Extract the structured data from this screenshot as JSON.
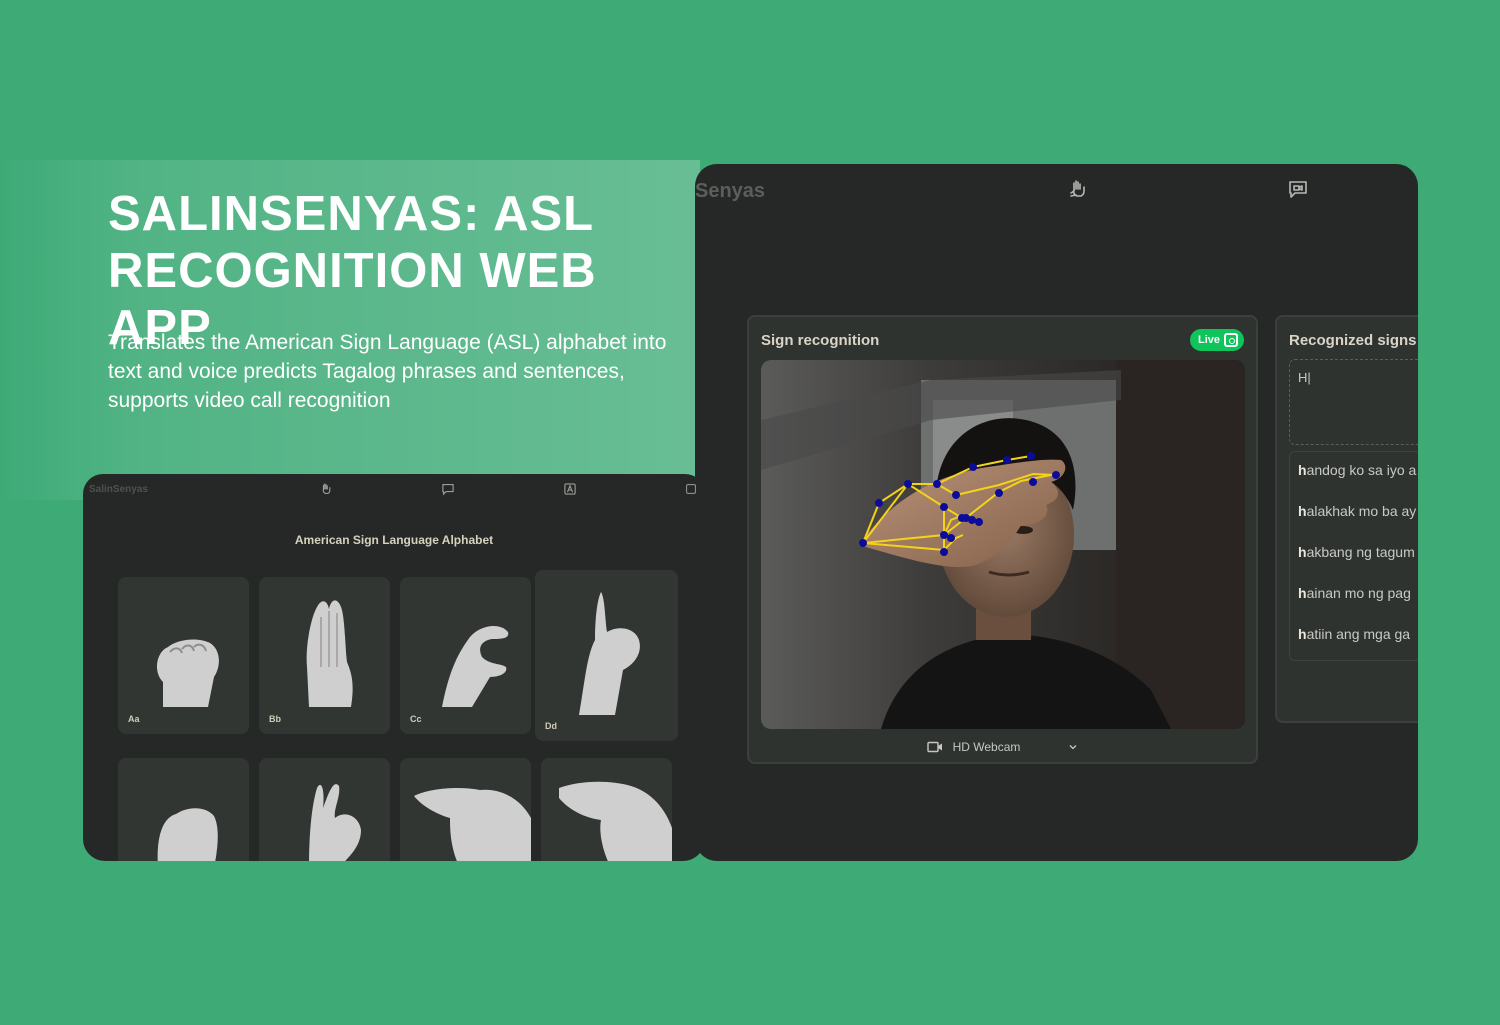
{
  "hero": {
    "title": "SALINSENYAS: ASL RECOGNITION WEB APP",
    "description": "Translates the American Sign Language (ASL) alphabet into text and voice predicts Tagalog phrases and sentences, supports video call recognition"
  },
  "main_app": {
    "logo": "Senyas",
    "nav_icons": [
      "sign-language-icon",
      "video-chat-icon"
    ],
    "sign_recognition": {
      "title": "Sign recognition",
      "live_badge": "Live",
      "camera_label": "HD Webcam"
    },
    "recognized_signs": {
      "title": "Recognized signs",
      "input_value": "H|",
      "suggestions": [
        {
          "prefix": "h",
          "rest": "andog ko sa iyo a"
        },
        {
          "prefix": "h",
          "rest": "alakhak mo ba ay"
        },
        {
          "prefix": "h",
          "rest": "akbang ng tagum"
        },
        {
          "prefix": "h",
          "rest": "ainan mo ng pag"
        },
        {
          "prefix": "h",
          "rest": "atiin ang mga ga"
        }
      ]
    }
  },
  "alphabet_app": {
    "logo": "SalinSenyas",
    "nav_icons": [
      "sign-language-icon",
      "video-chat-icon",
      "alphabet-icon",
      "settings-icon"
    ],
    "title": "American Sign Language Alphabet",
    "tiles": [
      "Aa",
      "Bb",
      "Cc",
      "Dd"
    ]
  },
  "colors": {
    "background": "#3eab77",
    "panel": "#252826",
    "card": "#2f3330",
    "live": "#10c45c",
    "landmark": "#0c0c9a",
    "skeleton": "#f2d21a"
  }
}
